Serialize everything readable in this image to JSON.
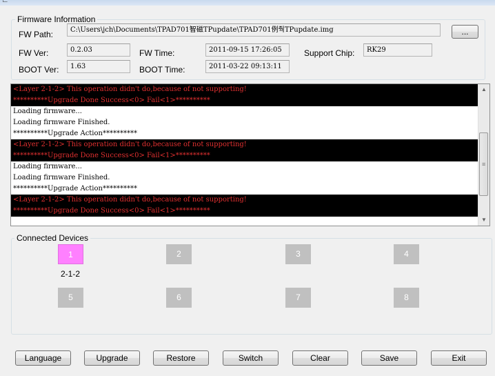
{
  "firmware": {
    "group_title": "Firmware Information",
    "fw_path_label": "FW Path:",
    "fw_path_value": "C:\\Users\\jch\\Documents\\TPAD701智磁TPupdate\\TPAD701例줙TPupdate.img",
    "browse_label": "...",
    "fw_ver_label": "FW Ver:",
    "fw_ver_value": "0.2.03",
    "fw_time_label": "FW Time:",
    "fw_time_value": "2011-09-15 17:26:05",
    "chip_label": "Support Chip:",
    "chip_value": "RK29",
    "boot_ver_label": "BOOT Ver:",
    "boot_ver_value": "1.63",
    "boot_time_label": "BOOT Time:",
    "boot_time_value": "2011-03-22 09:13:11"
  },
  "log": {
    "lines": [
      {
        "text": "<Layer 2-1-2> This operation didn't do,because of not supporting!",
        "type": "err"
      },
      {
        "text": "**********Upgrade Done Success<0> Fail<1>**********",
        "type": "err"
      },
      {
        "text": "Loading firmware...",
        "type": "ok"
      },
      {
        "text": "Loading firmware Finished.",
        "type": "ok"
      },
      {
        "text": "**********Upgrade Action**********",
        "type": "ok"
      },
      {
        "text": "<Layer 2-1-2> This operation didn't do,because of not supporting!",
        "type": "err"
      },
      {
        "text": "**********Upgrade Done Success<0> Fail<1>**********",
        "type": "err"
      },
      {
        "text": "Loading firmware...",
        "type": "ok"
      },
      {
        "text": "Loading firmware Finished.",
        "type": "ok"
      },
      {
        "text": "**********Upgrade Action**********",
        "type": "ok"
      },
      {
        "text": "<Layer 2-1-2> This operation didn't do,because of not supporting!",
        "type": "err"
      },
      {
        "text": "**********Upgrade Done Success<0> Fail<1>**********",
        "type": "err"
      }
    ]
  },
  "devices": {
    "group_title": "Connected Devices",
    "slots": [
      "1",
      "2",
      "3",
      "4",
      "5",
      "6",
      "7",
      "8"
    ],
    "active_slot_location": "2-1-2",
    "active_color": "#ff80ff",
    "inactive_color": "#c0c0c0"
  },
  "buttons": {
    "language": "Language",
    "upgrade": "Upgrade",
    "restore": "Restore",
    "switch": "Switch",
    "clear": "Clear",
    "save": "Save",
    "exit": "Exit"
  },
  "colors": {
    "error_bg": "#000000",
    "error_text": "#e03030"
  }
}
